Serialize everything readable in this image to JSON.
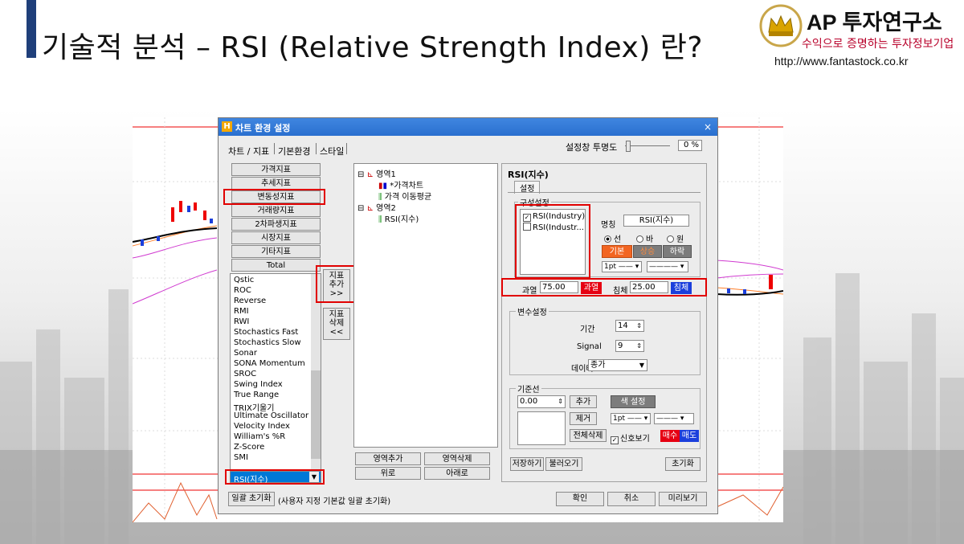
{
  "slide": {
    "title": "기술적 분석 – RSI (Relative Strength Index) 란?",
    "brand": "AP 투자연구소",
    "tagline": "수익으로 증명하는 투자정보기업",
    "url": "http://www.fantastock.co.kr"
  },
  "dialog": {
    "title": "차트 환경 설정",
    "close": "×",
    "tabs": [
      "차트 / 지표",
      "기본환경",
      "스타일"
    ],
    "transparency_label": "설정창 투명도",
    "transparency_value": "0 %",
    "categories": [
      "가격지표",
      "추세지표",
      "변동성지표",
      "거래량지표",
      "2차파생지표",
      "시장지표",
      "기타지표",
      "Total"
    ],
    "indicator_list": [
      "Qstic",
      "ROC",
      "Reverse",
      "RMI",
      "RWI",
      "Stochastics Fast",
      "Stochastics Slow",
      "Sonar",
      "SONA Momentum",
      "SROC",
      "Swing Index",
      "True Range",
      "TRIX기울기",
      "Ultimate Oscillator",
      "Velocity Index",
      "William's %R",
      "Z-Score",
      "SMI"
    ],
    "selected_indicator": "RSI(지수)",
    "add_button": [
      "지표",
      "추가",
      ">>"
    ],
    "delete_button": [
      "지표",
      "삭제",
      "<<"
    ],
    "tree": {
      "area1": "영역1",
      "area1_items": [
        "*가격차트",
        "가격 이동평균"
      ],
      "area2": "영역2",
      "area2_items": [
        "RSI(지수)"
      ]
    },
    "area_add": "영역추가",
    "area_delete": "영역삭제",
    "move_up": "위로",
    "move_down": "아래로",
    "panel_title": "RSI(지수)",
    "settings_tab": "설정",
    "composition_label": "구성설정",
    "composition_items": [
      {
        "label": "RSI(Industry)",
        "checked": true
      },
      {
        "label": "RSI(Industr...",
        "checked": false
      }
    ],
    "name_label": "명칭",
    "name_value": "RSI(지수)",
    "chart_type_options": [
      "선",
      "바",
      "원"
    ],
    "chart_type_selected": "선",
    "color_tabs": [
      "기본",
      "상승",
      "하락"
    ],
    "line_width": "1pt",
    "overbought_label": "과열",
    "overbought_value": "75.00",
    "overbought_button": "과열",
    "oversold_label": "침체",
    "oversold_value": "25.00",
    "oversold_button": "침체",
    "variable_label": "변수설정",
    "period_label": "기간",
    "period_value": "14",
    "signal_label": "Signal",
    "signal_value": "9",
    "data_label": "데이터",
    "data_value": "종가",
    "baseline_label": "기준선",
    "baseline_value": "0.00",
    "baseline_add": "추가",
    "baseline_color": "색 설정",
    "baseline_remove": "제거",
    "baseline_clear": "전체삭제",
    "signal_view_label": "신호보기",
    "buy_label": "매수",
    "sell_label": "매도",
    "save_label": "저장하기",
    "load_label": "불러오기",
    "reset_label": "초기화",
    "bulk_reset_label": "일괄 초기화",
    "bulk_reset_note": "(사용자 지정 기본값 일괄 초기화)",
    "ok_label": "확인",
    "cancel_label": "취소",
    "preview_label": "미리보기"
  },
  "colors": {
    "accent_red": "#e10000",
    "title_bar_blue": "#2a6fcf",
    "buy_red": "#e60012",
    "sell_blue": "#1b3fdc",
    "brand_red": "#b8002a"
  }
}
